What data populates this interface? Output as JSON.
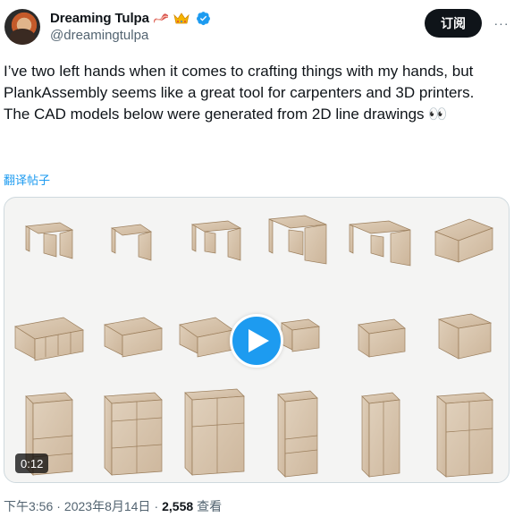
{
  "author": {
    "display_name": "Dreaming Tulpa",
    "handle": "@dreamingtulpa",
    "badges": [
      "bacon-emoji",
      "crown-emoji",
      "verified-badge-icon"
    ]
  },
  "actions": {
    "subscribe_label": "订阅",
    "more_label": "···"
  },
  "tweet": {
    "text": "I’ve two left hands when it comes to crafting things with my hands, but\nPlankAssembly seems like a great tool for carpenters and 3D printers.\nThe CAD models below were generated from 2D line drawings 👀",
    "translate_label": "翻译帖子"
  },
  "media": {
    "type": "video",
    "duration": "0:12",
    "play_icon": "play-icon"
  },
  "meta": {
    "time": "下午3:56",
    "date": "2023年8月14日",
    "separator": "·",
    "views_count": "2,558",
    "views_label": "查看"
  },
  "colors": {
    "accent": "#1d9bf0",
    "text": "#0f1419",
    "secondary": "#536471",
    "wood": "#c9ad8c"
  }
}
